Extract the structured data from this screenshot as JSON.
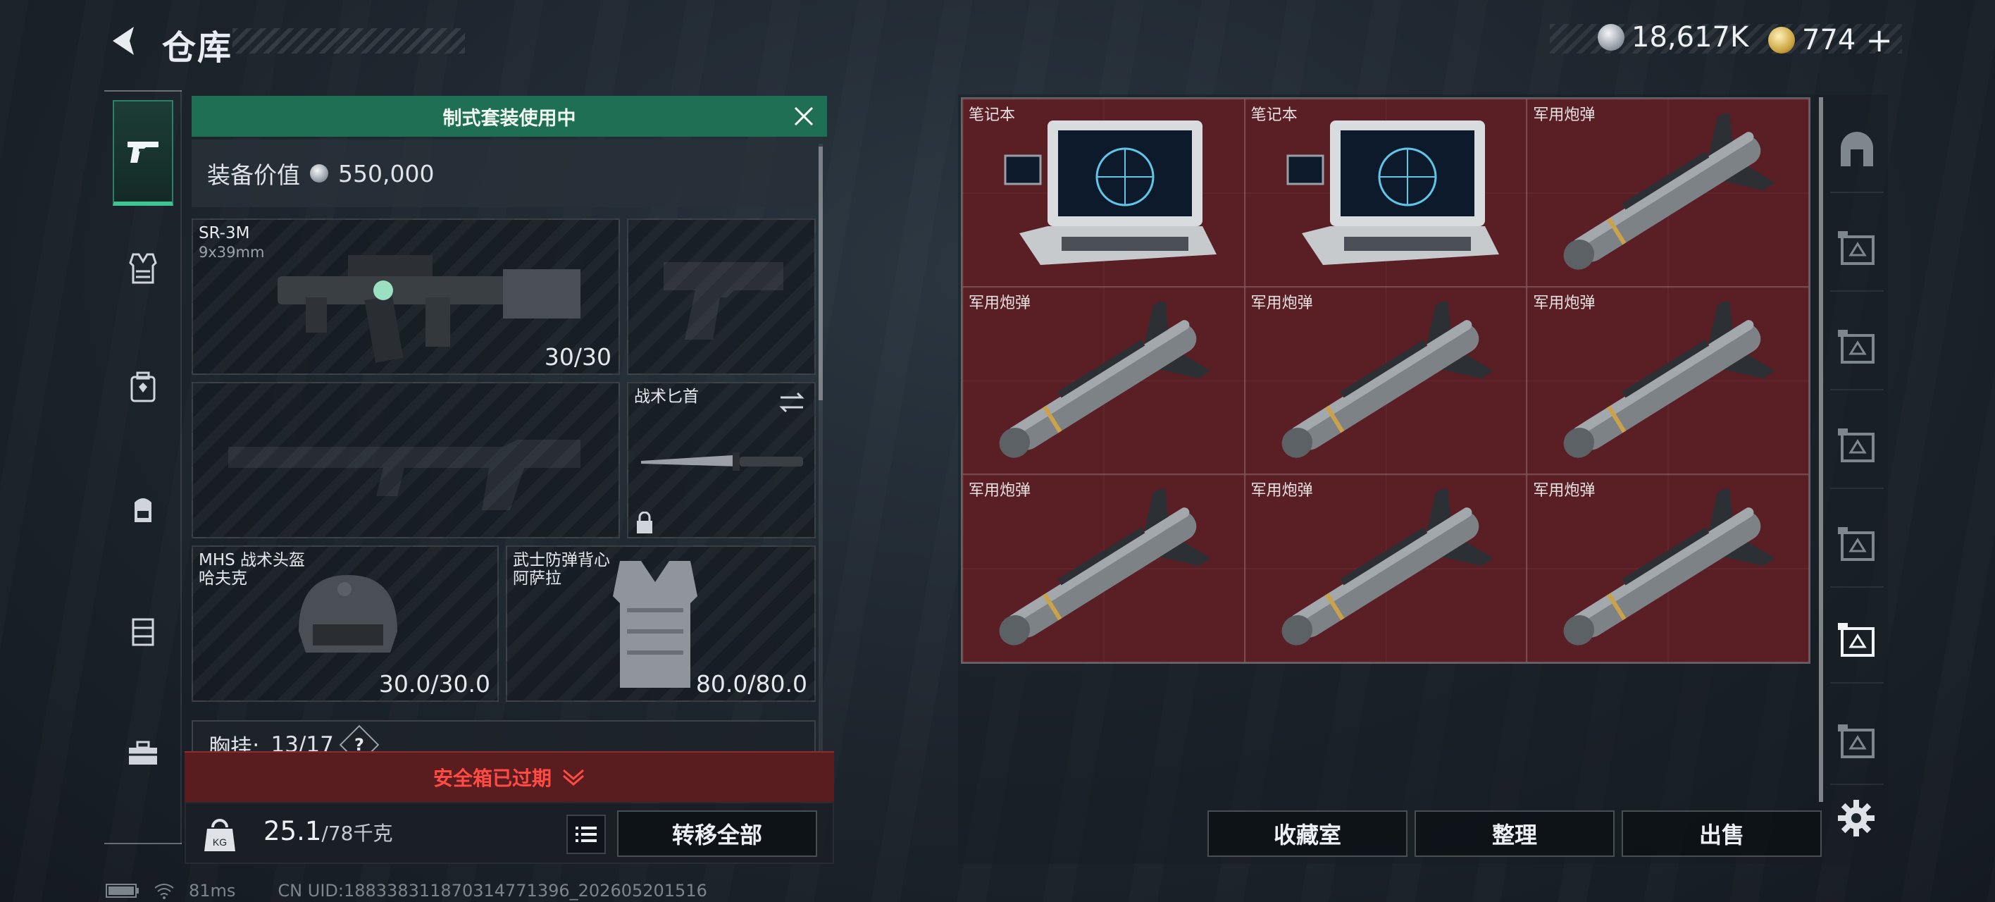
{
  "header": {
    "title": "仓库",
    "currency_silver": "18,617K",
    "currency_gold": "774",
    "add_symbol": "+"
  },
  "left_nav": {
    "items": [
      {
        "name": "weapons",
        "icon": "pistol-icon",
        "active": true
      },
      {
        "name": "armor",
        "icon": "vest-icon",
        "active": false
      },
      {
        "name": "medical",
        "icon": "med-bag-icon",
        "active": false
      },
      {
        "name": "backpack",
        "icon": "backpack-icon",
        "active": false
      },
      {
        "name": "rig",
        "icon": "rig-icon",
        "active": false
      },
      {
        "name": "toolbox",
        "icon": "toolbox-icon",
        "active": false
      }
    ]
  },
  "loadout": {
    "banner": "制式套装使用中",
    "value_label": "装备价值",
    "value": "550,000",
    "primary_weapon": {
      "name": "SR-3M",
      "ammo_type": "9x39mm",
      "ammo": "30/30"
    },
    "knife": {
      "name": "战术匕首"
    },
    "helmet": {
      "name": "MHS 战术头盔",
      "brand": "哈夫克",
      "durability": "30.0/30.0"
    },
    "armor": {
      "name": "武士防弹背心",
      "brand": "阿萨拉",
      "durability": "80.0/80.0"
    },
    "chest_rig": {
      "label": "胸挂:",
      "capacity": "13/17",
      "help": "?"
    }
  },
  "safe_box": {
    "expired_text": "安全箱已过期"
  },
  "weight": {
    "current": "25.1",
    "max": "/78千克"
  },
  "actions": {
    "transfer_all": "转移全部",
    "collection": "收藏室",
    "sort": "整理",
    "sell": "出售"
  },
  "status": {
    "ping": "81ms",
    "uid": "CN UID:18833831187031477139​6_202605201516"
  },
  "storage": {
    "items": [
      {
        "label": "笔记本",
        "icon": "laptop-icon"
      },
      {
        "label": "笔记本",
        "icon": "laptop-icon"
      },
      {
        "label": "军用炮弹",
        "icon": "missile-icon"
      },
      {
        "label": "军用炮弹",
        "icon": "missile-icon"
      },
      {
        "label": "军用炮弹",
        "icon": "missile-icon"
      },
      {
        "label": "军用炮弹",
        "icon": "missile-icon"
      },
      {
        "label": "军用炮弹",
        "icon": "missile-icon"
      },
      {
        "label": "军用炮弹",
        "icon": "missile-icon"
      },
      {
        "label": "军用炮弹",
        "icon": "missile-icon"
      }
    ]
  },
  "right_tabs": {
    "items": [
      {
        "name": "tab-home",
        "icon": "arch-icon",
        "active": false
      },
      {
        "name": "tab-level-3a",
        "icon": "stash-level-iii-icon",
        "active": false
      },
      {
        "name": "tab-level-3b",
        "icon": "stash-level-iii-icon",
        "active": false
      },
      {
        "name": "tab-level-4a",
        "icon": "stash-level-iv-icon",
        "active": false
      },
      {
        "name": "tab-level-5",
        "icon": "stash-level-v-icon",
        "active": false
      },
      {
        "name": "tab-level-4b",
        "icon": "stash-level-iv-icon",
        "active": true
      },
      {
        "name": "tab-level-4c",
        "icon": "stash-level-iv-icon",
        "active": false
      }
    ]
  },
  "colors": {
    "accent_green": "#1f6f55",
    "storage_cell": "#5a1f25",
    "expired_red": "#ff4b44"
  }
}
